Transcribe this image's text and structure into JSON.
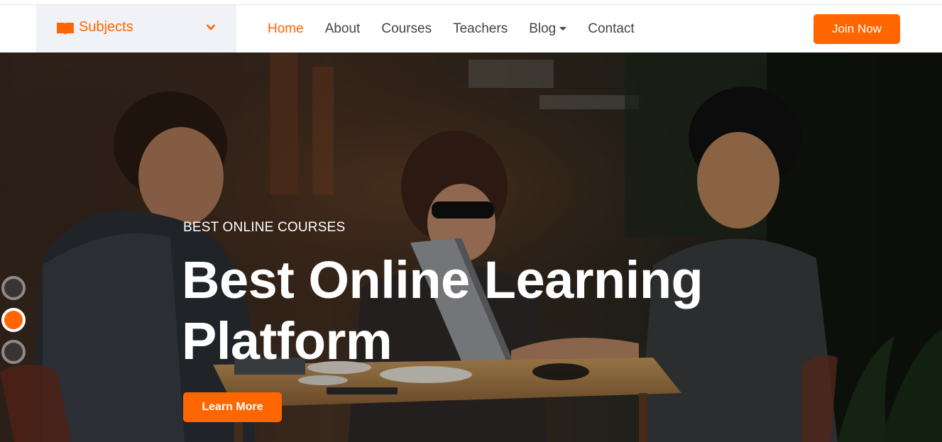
{
  "nav": {
    "subjects_label": "Subjects",
    "links": [
      {
        "label": "Home",
        "active": true
      },
      {
        "label": "About",
        "active": false
      },
      {
        "label": "Courses",
        "active": false
      },
      {
        "label": "Teachers",
        "active": false
      },
      {
        "label": "Blog",
        "active": false,
        "dropdown": true
      },
      {
        "label": "Contact",
        "active": false
      }
    ],
    "join_label": "Join Now"
  },
  "hero": {
    "kicker": "BEST ONLINE COURSES",
    "headline_line1": "Best Online Learning",
    "headline_line2": "Platform",
    "button_label": "Learn More",
    "carousel_active_index": 1,
    "carousel_count": 3
  },
  "colors": {
    "accent": "#ff6600",
    "subjects_bg": "#f1f1f8",
    "nav_text": "#444444"
  },
  "icons": [
    "book-icon",
    "chevron-down-icon",
    "caret-down-icon"
  ]
}
